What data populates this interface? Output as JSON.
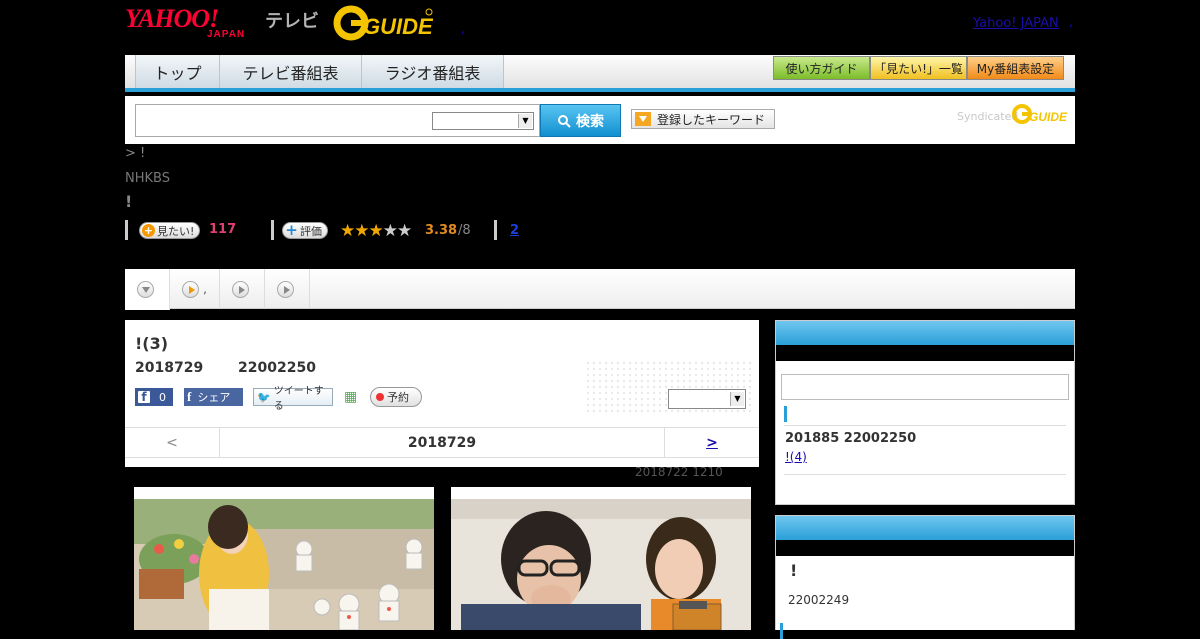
{
  "header": {
    "yahoo_logo": "YAHOO!",
    "yahoo_sub": "JAPAN",
    "tv_label": "テレビ",
    "gguide_logo": "G-GUIDE",
    "yahoo_japan_link": "Yahoo! JAPAN",
    "sep1": ",",
    "sep2": ","
  },
  "nav": {
    "tabs": [
      "トップ",
      "テレビ番組表",
      "ラジオ番組表"
    ],
    "buttons": [
      "使い方ガイド",
      "「見たい!」一覧",
      "My番組表設定"
    ]
  },
  "search": {
    "input_value": "",
    "select_value": "",
    "button_label": "検索",
    "keyword_button": "登録したキーワード",
    "syndicated": "Syndicated",
    "syn_logo": "G-GUIDE"
  },
  "breadcrumb": "> !",
  "channel": "NHKBS",
  "program_title": "!",
  "rating": {
    "mitai_label": "見たい!",
    "mitai_count": "117",
    "eval_label": "評価",
    "stars_filled": 3,
    "stars_total": 5,
    "score": "3.38",
    "score_den": "/8",
    "review_link": "2"
  },
  "tabs": [
    {
      "label": "",
      "icon": "chevron-down-icon"
    },
    {
      "label": ",",
      "icon": "play-icon"
    },
    {
      "label": "",
      "icon": "play-icon"
    },
    {
      "label": "",
      "icon": "play-icon"
    }
  ],
  "main": {
    "title": "!(3)",
    "date": "2018729",
    "time": "22002250",
    "fb_count": "0",
    "share_label": "シェア",
    "tweet_label": "ツイートする",
    "reserve_label": "予約",
    "select_value": "",
    "pager_prev": "<",
    "pager_date": "2018729",
    "pager_next": ">",
    "updated": "2018722  1210"
  },
  "sidebar": {
    "input_value": "",
    "next_datetime": "201885  22002250",
    "next_link": "!(4)",
    "box2_title": "!",
    "box2_time": "22002249"
  },
  "colors": {
    "accent_blue": "#2a9fd8",
    "brand_red": "#ff0033",
    "mitai_pink": "#e04070",
    "star_gold": "#f0a800"
  }
}
